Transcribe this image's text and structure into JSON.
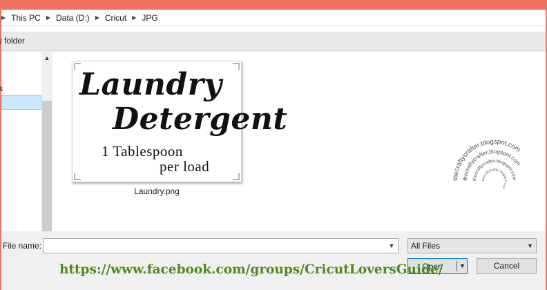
{
  "address_bar": {
    "breadcrumbs": [
      "This PC",
      "Data (D:)",
      "Cricut",
      "JPG"
    ],
    "separator_icon": "chevron-right-icon"
  },
  "toolbar": {
    "new_folder_label": "w folder"
  },
  "nav_pane": {
    "partial_item_label": "s",
    "scroll_up_icon": "chevron-up-icon"
  },
  "files": [
    {
      "name": "Laundry.png",
      "thumbnail_text": [
        "Laundry",
        "Detergent",
        "1 Tablespoon",
        "per load"
      ]
    }
  ],
  "watermark": {
    "text": "thecraftycrafter.blogspot.com"
  },
  "file_name_field": {
    "label": "File name:",
    "value": ""
  },
  "file_type_select": {
    "selected": "All Files"
  },
  "buttons": {
    "open": "Open",
    "cancel": "Cancel"
  },
  "overlay_link": {
    "text": "https://www.facebook.com/groups/CricutLoversGuide/",
    "color": "#4f8a1f"
  },
  "colors": {
    "frame_accent": "#f07262",
    "selection": "#cce8ff"
  }
}
